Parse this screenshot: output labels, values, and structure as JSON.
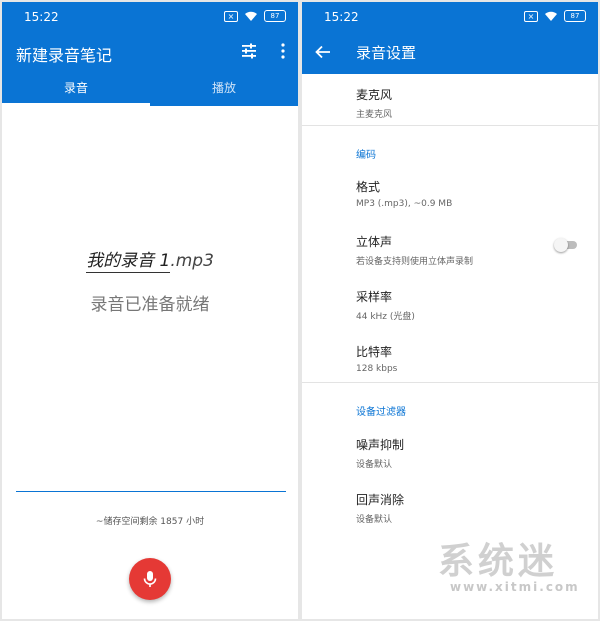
{
  "left": {
    "status": {
      "time": "15:22",
      "battery": "87"
    },
    "appbar": {
      "title": "新建录音笔记"
    },
    "tabs": [
      {
        "label": "录音"
      },
      {
        "label": "播放"
      }
    ],
    "recording": {
      "filename_base": "我的录音 1",
      "filename_ext": ".mp3",
      "status": "录音已准备就绪",
      "storage": "~储存空间剩余 1857 小时"
    }
  },
  "right": {
    "status": {
      "time": "15:22",
      "battery": "87"
    },
    "appbar": {
      "title": "录音设置"
    },
    "settings": {
      "microphone": {
        "title": "麦克风",
        "subtitle": "主麦克风"
      },
      "encoding_header": "编码",
      "format": {
        "title": "格式",
        "subtitle": "MP3 (.mp3), ~0.9 MB"
      },
      "stereo": {
        "title": "立体声",
        "subtitle": "若设备支持则使用立体声录制",
        "enabled": false
      },
      "sample_rate": {
        "title": "采样率",
        "subtitle": "44 kHz (光盘)"
      },
      "bitrate": {
        "title": "比特率",
        "subtitle": "128 kbps"
      },
      "filters_header": "设备过滤器",
      "noise": {
        "title": "噪声抑制",
        "subtitle": "设备默认"
      },
      "echo": {
        "title": "回声消除",
        "subtitle": "设备默认"
      }
    }
  },
  "watermark": {
    "main": "系统迷",
    "url": "www.xitmi.com"
  },
  "colors": {
    "primary": "#0a74d4",
    "fab": "#e53935",
    "accent_text": "#0a74d4"
  },
  "icons": [
    "tune-icon",
    "more-vert-icon",
    "mic-icon",
    "back-arrow-icon",
    "wifi-icon"
  ]
}
